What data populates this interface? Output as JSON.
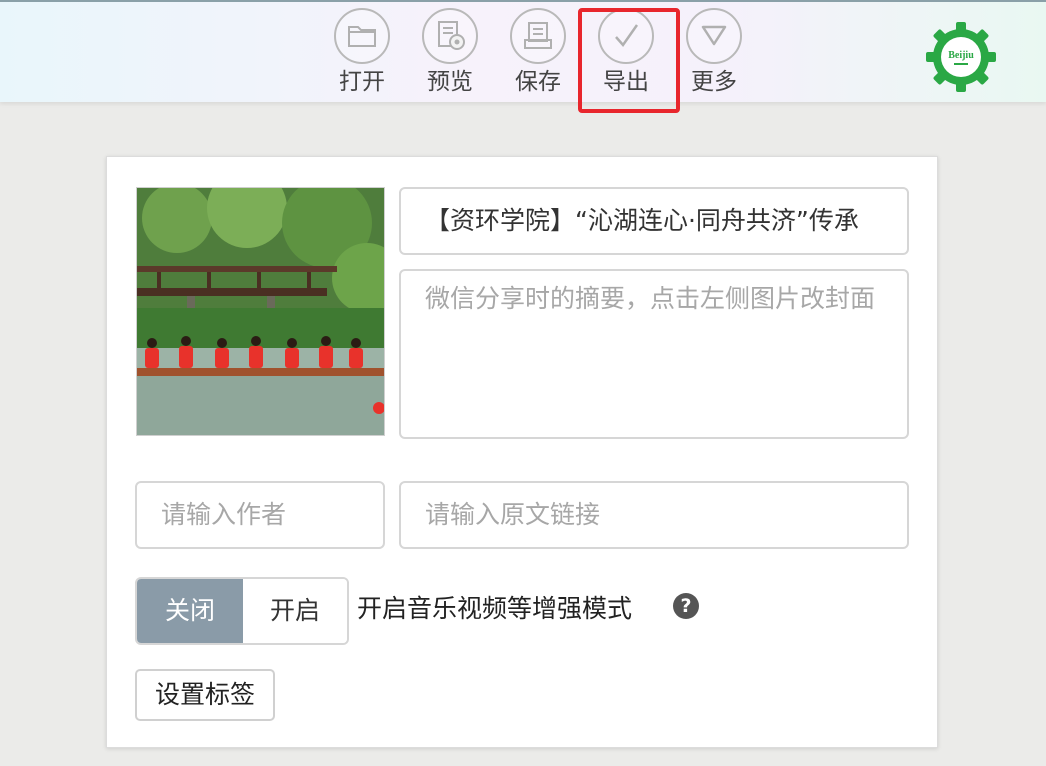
{
  "toolbar": {
    "open_label": "打开",
    "preview_label": "预览",
    "save_label": "保存",
    "export_label": "导出",
    "more_label": "更多"
  },
  "logo": {
    "text": "Beijiu",
    "color": "#2aa845"
  },
  "highlight_color": "#e8262d",
  "article": {
    "title": "【资环学院】“沁湖连心·同舟共济”传承",
    "summary_placeholder": "微信分享时的摘要，点击左侧图片改封面",
    "author_placeholder": "请输入作者",
    "link_placeholder": "请输入原文链接"
  },
  "enhance": {
    "off_label": "关闭",
    "on_label": "开启",
    "description": "开启音乐视频等增强模式",
    "help": "?"
  },
  "tags": {
    "button_label": "设置标签"
  }
}
